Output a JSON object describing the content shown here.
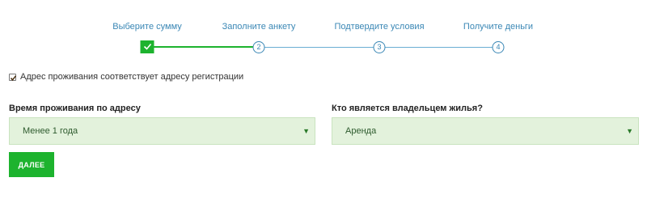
{
  "stepper": {
    "steps": [
      {
        "label": "Выберите сумму",
        "number": "1",
        "state": "done"
      },
      {
        "label": "Заполните анкету",
        "number": "2",
        "state": "todo"
      },
      {
        "label": "Подтвердите условия",
        "number": "3",
        "state": "todo"
      },
      {
        "label": "Получите деньги",
        "number": "4",
        "state": "todo"
      }
    ]
  },
  "address_match": {
    "checked": true,
    "label": "Адрес проживания соответствует адресу регистрации"
  },
  "residence_duration": {
    "label": "Время проживания по адресу",
    "value": "Менее 1 года"
  },
  "housing_owner": {
    "label": "Кто является владельцем жилья?",
    "value": "Аренда"
  },
  "next_button": {
    "label": "ДАЛЕЕ"
  },
  "colors": {
    "accent_green": "#1db32e",
    "step_blue": "#3a87b5",
    "select_bg": "#e3f2dc"
  }
}
